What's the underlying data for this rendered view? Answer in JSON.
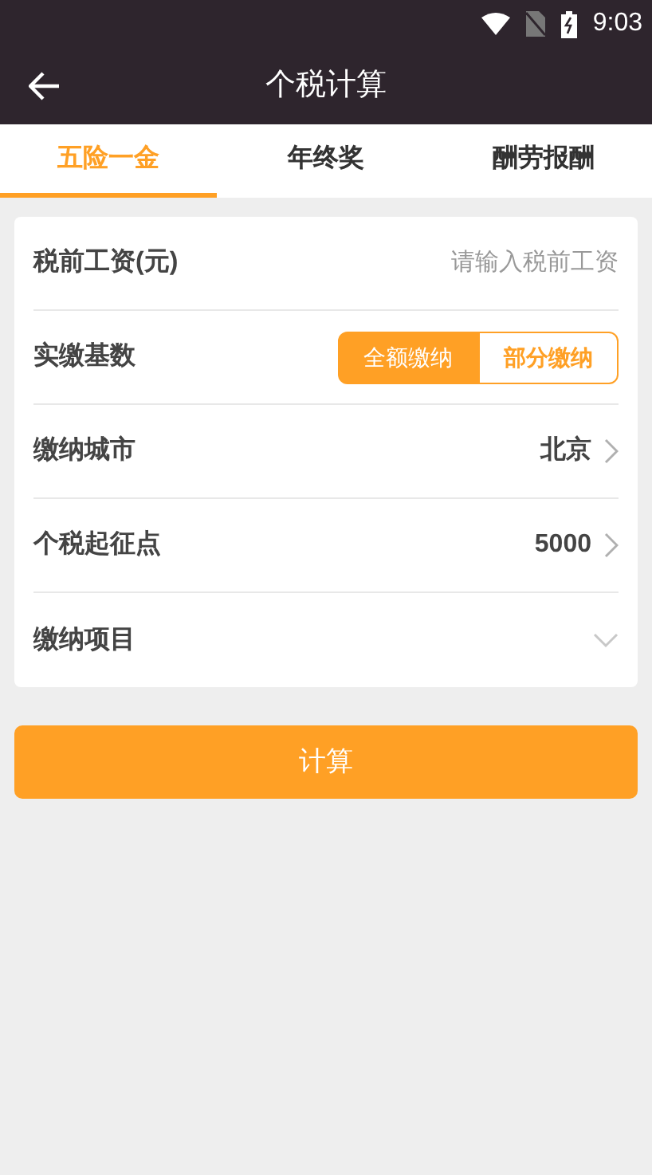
{
  "status_bar": {
    "time": "9:03"
  },
  "app_bar": {
    "title": "个税计算"
  },
  "tabs": [
    {
      "label": "五险一金",
      "selected": true
    },
    {
      "label": "年终奖",
      "selected": false
    },
    {
      "label": "酬劳报酬",
      "selected": false
    }
  ],
  "form": [
    {
      "kind": "input",
      "label": "税前工资(元)",
      "placeholder": "请输入税前工资"
    },
    {
      "kind": "segmented",
      "label": "实缴基数",
      "options": [
        {
          "label": "全额缴纳",
          "selected": true
        },
        {
          "label": "部分缴纳",
          "selected": false
        }
      ]
    },
    {
      "kind": "link",
      "label": "缴纳城市",
      "value": "北京"
    },
    {
      "kind": "link",
      "label": "个税起征点",
      "value": "5000"
    },
    {
      "kind": "dropdown",
      "label": "缴纳项目"
    }
  ],
  "submit_button": "计算"
}
